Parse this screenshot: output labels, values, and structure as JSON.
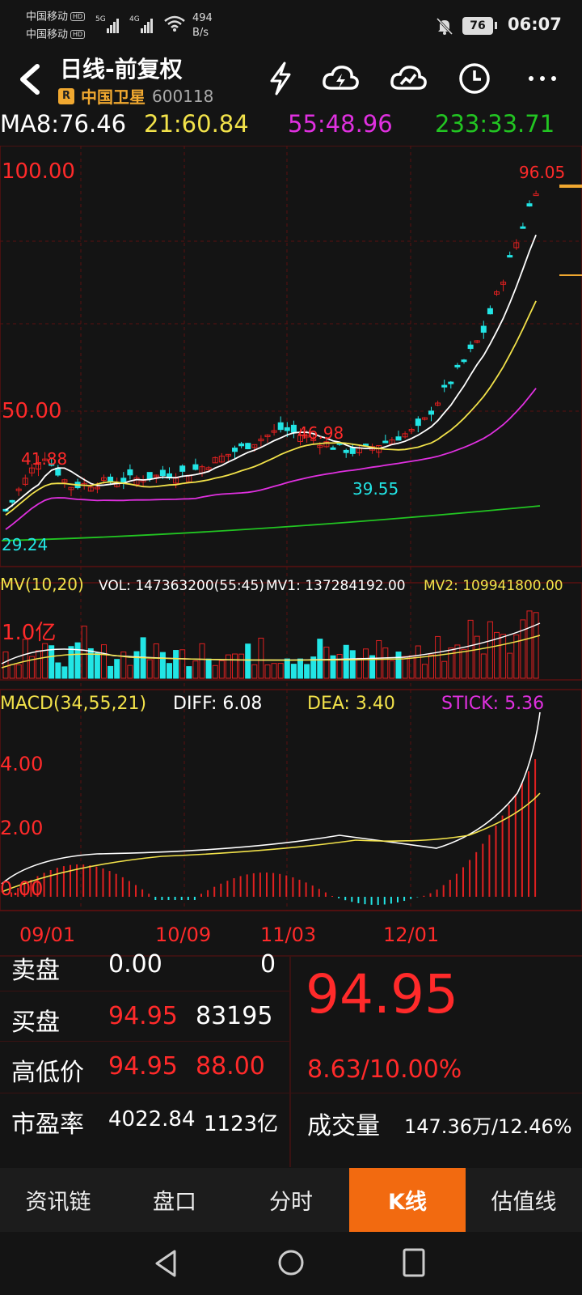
{
  "status": {
    "carrier1": "中国移动",
    "carrier2": "中国移动",
    "hd": "HD",
    "net1": "5G",
    "net2": "4G",
    "speed_value": "494",
    "speed_unit": "B/s",
    "battery": "76",
    "time": "06:07"
  },
  "header": {
    "title": "日线-前复权",
    "badge": "R",
    "stock_name": "中国卫星",
    "stock_code": "600118"
  },
  "ma": {
    "ma8": "MA8:76.46",
    "ma21": "21:60.84",
    "ma55": "55:48.96",
    "ma233": "233:33.71"
  },
  "chart": {
    "price_top_label": "100.00",
    "price_mid_label": "50.00",
    "high_label": "96.05",
    "peak_label": "46.98",
    "left_peak_label": "41.88",
    "low_label": "39.55",
    "bottom_label": "29.24",
    "vol_header_name": "MV(10,20)",
    "vol_header_vol": "VOL: 147363200(55:45)",
    "vol_header_mv1": "MV1: 137284192.00",
    "vol_header_mv2": "MV2: 109941800.00",
    "vol_axis_label": "1.0亿",
    "macd_name": "MACD(34,55,21)",
    "macd_diff": "DIFF: 6.08",
    "macd_dea": "DEA: 3.40",
    "macd_stick": "STICK: 5.36",
    "macd_4": "4.00",
    "macd_2": "2.00",
    "macd_0": "0.00",
    "dates": [
      "09/01",
      "10/09",
      "11/03",
      "12/01"
    ],
    "colors": {
      "up": "#e02020",
      "down": "#22e5e5",
      "ma8": "#ffffff",
      "ma21": "#f2e24a",
      "ma55": "#e030e0",
      "ma233": "#22c522",
      "grid": "#5a1010"
    }
  },
  "quote": {
    "sell_label": "卖盘",
    "sell_price": "0.00",
    "sell_vol": "0",
    "buy_label": "买盘",
    "buy_price": "94.95",
    "buy_vol": "83195",
    "hilo_label": "高低价",
    "high": "94.95",
    "low": "88.00",
    "pe_label": "市盈率",
    "pe": "4022.84",
    "mcap": "1123亿",
    "price": "94.95",
    "change": "8.63/10.00%",
    "volume_label": "成交量",
    "volume": "147.36万/12.46%"
  },
  "tabs": [
    "资讯链",
    "盘口",
    "分时",
    "K线",
    "估值线"
  ],
  "active_tab": "K线"
}
